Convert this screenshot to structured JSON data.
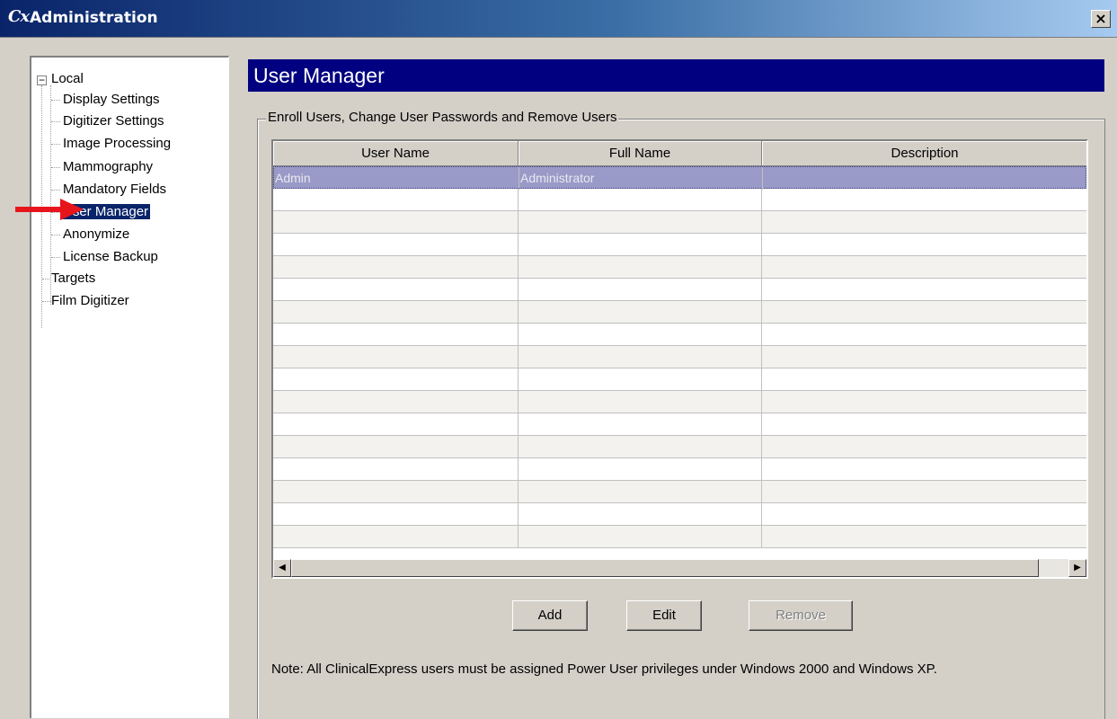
{
  "window": {
    "icon_text": "Cx",
    "title": "Administration",
    "close_label": "×"
  },
  "tree": {
    "items": [
      {
        "label": "Local",
        "expander": "−"
      },
      {
        "label": "Display Settings"
      },
      {
        "label": "Digitizer Settings"
      },
      {
        "label": "Image Processing"
      },
      {
        "label": "Mammography"
      },
      {
        "label": "Mandatory Fields"
      },
      {
        "label": "User Manager",
        "selected": true
      },
      {
        "label": "Anonymize"
      },
      {
        "label": "License Backup"
      },
      {
        "label": "Targets"
      },
      {
        "label": "Film Digitizer"
      }
    ]
  },
  "panel": {
    "title": "User Manager",
    "group_label": "Enroll Users, Change User Passwords and Remove Users"
  },
  "table": {
    "columns": [
      "User Name",
      "Full Name",
      "Description"
    ],
    "rows": [
      [
        "Admin",
        "Administrator",
        ""
      ]
    ]
  },
  "buttons": {
    "add": "Add",
    "edit": "Edit",
    "remove": "Remove"
  },
  "note": "Note: All ClinicalExpress users must be assigned Power User privileges under Windows 2000 and Windows XP.",
  "colors": {
    "title_bar": "#0a246a",
    "panel_header": "#000080",
    "selection": "#0a246a",
    "arrow": "#e8141c"
  }
}
